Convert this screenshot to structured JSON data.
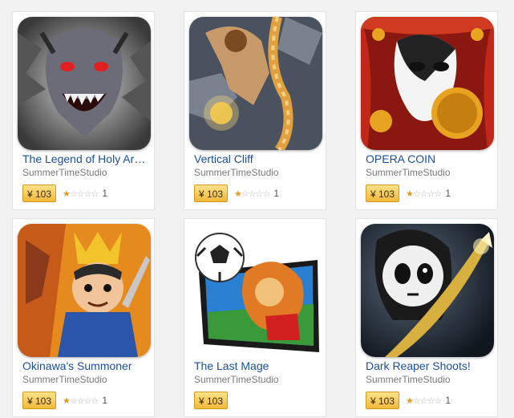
{
  "apps": [
    {
      "title": "The Legend of Holy Archer",
      "developer": "SummerTimeStudio",
      "price": "¥ 103",
      "rating": 1,
      "rating_count": "1",
      "icon": "demon-icon",
      "colors": {
        "bg": "#8a8a8a",
        "accent": "#cc2222"
      }
    },
    {
      "title": "Vertical Cliff",
      "developer": "SummerTimeStudio",
      "price": "¥ 103",
      "rating": 1,
      "rating_count": "1",
      "icon": "climber-icon",
      "colors": {
        "bg": "#556070",
        "accent": "#f0b040"
      }
    },
    {
      "title": "OPERA COIN",
      "developer": "SummerTimeStudio",
      "price": "¥ 103",
      "rating": 1,
      "rating_count": "1",
      "icon": "opera-mask-icon",
      "colors": {
        "bg": "#9b1a12",
        "accent": "#e8a320"
      }
    },
    {
      "title": "Okinawa's Summoner",
      "developer": "SummerTimeStudio",
      "price": "¥ 103",
      "rating": 1,
      "rating_count": "1",
      "icon": "samurai-icon",
      "colors": {
        "bg": "#d5701a",
        "accent": "#2a55a8"
      }
    },
    {
      "title": "The Last Mage",
      "developer": "SummerTimeStudio",
      "price": "¥ 103",
      "rating": null,
      "rating_count": "",
      "icon": "soccer-lion-icon",
      "colors": {
        "bg": "#ffffff",
        "accent": "#2a7fd0"
      }
    },
    {
      "title": "Dark Reaper Shoots!",
      "developer": "SummerTimeStudio",
      "price": "¥ 103",
      "rating": 1,
      "rating_count": "1",
      "icon": "reaper-icon",
      "colors": {
        "bg": "#1e2a38",
        "accent": "#d8b040"
      }
    }
  ],
  "colors": {
    "title_link": "#1a4f9c",
    "developer": "#7a7a7a",
    "price_bg": "#f6cc55",
    "star_on": "#e39a1c"
  }
}
